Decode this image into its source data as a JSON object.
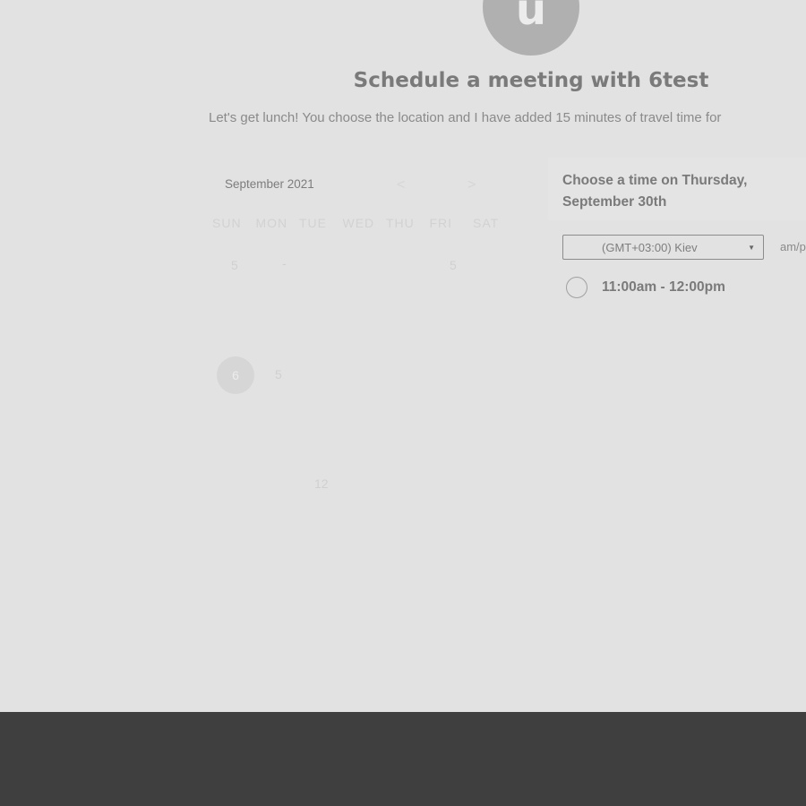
{
  "host": {
    "avatar_initial": "u",
    "title": "Schedule a meeting with 6test",
    "description": "Let's get lunch! You choose the location and I have added 15 minutes of travel time for"
  },
  "calendar": {
    "month_label": "September 2021",
    "prev_icon": "chevron-left-icon",
    "next_icon": "chevron-right-icon",
    "prev_glyph": "<",
    "next_glyph": ">",
    "weekdays": [
      "SUN",
      "MON",
      "TUE",
      "WED",
      "THU",
      "FRI",
      "SAT"
    ],
    "visible_days": [
      "5",
      "-",
      "5",
      "5",
      "12"
    ],
    "selected_day": "6"
  },
  "times": {
    "heading": "Choose a time on Thursday, September 30th",
    "timezone": "(GMT+03:00) Kiev",
    "format_toggle": "am/p",
    "slots": [
      "11:00am - 12:00pm"
    ]
  }
}
